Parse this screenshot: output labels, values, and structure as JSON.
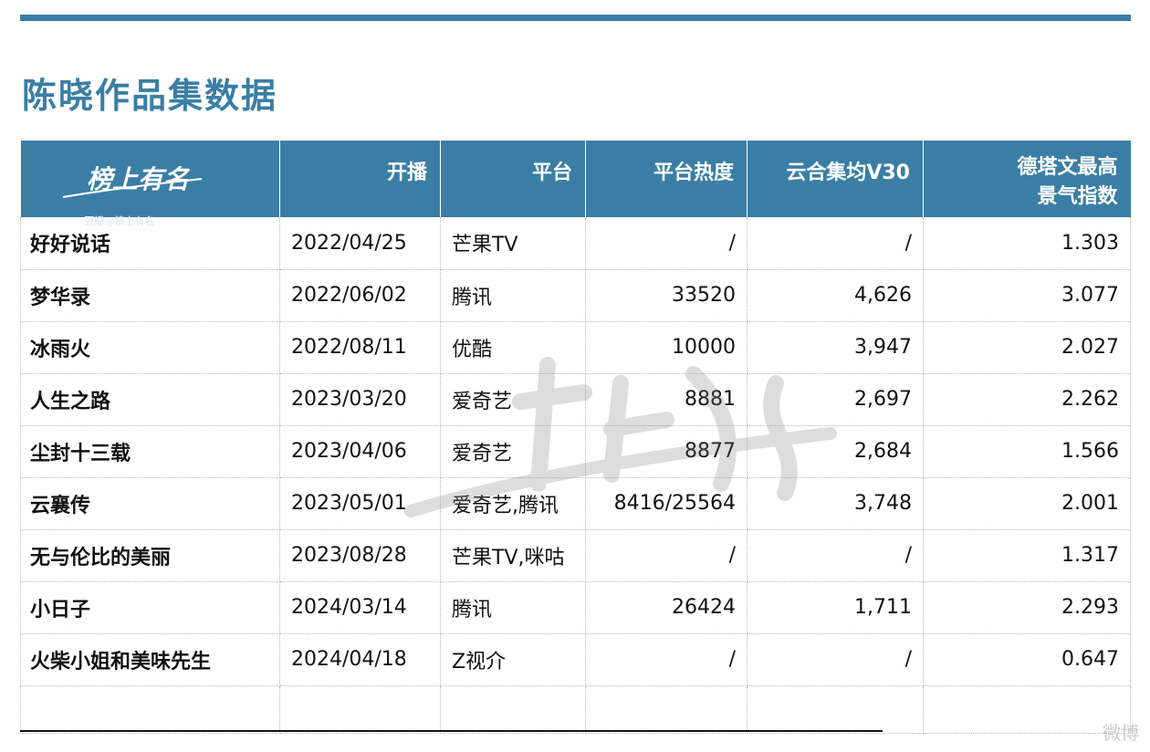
{
  "page": {
    "title": "陈晓作品集数据",
    "logo_text": "榜上有名",
    "logo_sub": "豆瓣@榜上有名",
    "corner_watermark": "微博"
  },
  "table": {
    "headers": [
      "",
      "开播",
      "平台",
      "平台热度",
      "云合集均V30",
      "德塔文最高\n景气指数"
    ],
    "rows": [
      [
        "好好说话",
        "2022/04/25",
        "芒果TV",
        "/",
        "/",
        "1.303"
      ],
      [
        "梦华录",
        "2022/06/02",
        "腾讯",
        "33520",
        "4,626",
        "3.077"
      ],
      [
        "冰雨火",
        "2022/08/11",
        "优酷",
        "10000",
        "3,947",
        "2.027"
      ],
      [
        "人生之路",
        "2023/03/20",
        "爱奇艺",
        "8881",
        "2,697",
        "2.262"
      ],
      [
        "尘封十三载",
        "2023/04/06",
        "爱奇艺",
        "8877",
        "2,684",
        "1.566"
      ],
      [
        "云襄传",
        "2023/05/01",
        "爱奇艺,腾讯",
        "8416/25564",
        "3,748",
        "2.001"
      ],
      [
        "无与伦比的美丽",
        "2023/08/28",
        "芒果TV,咪咕",
        "/",
        "/",
        "1.317"
      ],
      [
        "小日子",
        "2024/03/14",
        "腾讯",
        "26424",
        "1,711",
        "2.293"
      ],
      [
        "火柴小姐和美味先生",
        "2024/04/18",
        "Z视介",
        "/",
        "/",
        "0.647"
      ]
    ]
  },
  "colors": {
    "accent": "#3a7ea5",
    "text": "#111111"
  }
}
